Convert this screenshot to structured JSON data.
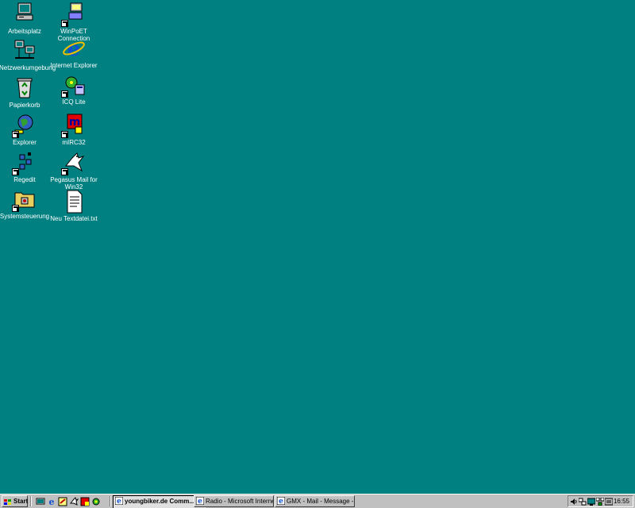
{
  "desktop": {
    "background": "#008080",
    "icons": [
      {
        "label": "Arbeitsplatz",
        "icon": "my-computer-icon"
      },
      {
        "label": "WinPoET Connection",
        "icon": "winpoet-icon"
      },
      {
        "label": "Netzwerkumgebung",
        "icon": "network-neighborhood-icon"
      },
      {
        "label": "Internet Explorer",
        "icon": "internet-explorer-icon"
      },
      {
        "label": "Papierkorb",
        "icon": "recycle-bin-icon"
      },
      {
        "label": "ICQ Lite",
        "icon": "icq-icon"
      },
      {
        "label": "Explorer",
        "icon": "explorer-icon"
      },
      {
        "label": "mIRC32",
        "icon": "mirc-icon"
      },
      {
        "label": "Regedit",
        "icon": "regedit-icon"
      },
      {
        "label": "Pegasus Mail for Win32",
        "icon": "pegasus-mail-icon"
      },
      {
        "label": "Systemsteuerung",
        "icon": "control-panel-icon"
      },
      {
        "label": "Neu Textdatei.txt",
        "icon": "text-file-icon"
      }
    ]
  },
  "taskbar": {
    "start_label": "Start",
    "tasks": [
      {
        "label": "youngbiker.de Comm...",
        "active": true
      },
      {
        "label": "Radio - Microsoft Internet ...",
        "active": false
      },
      {
        "label": "GMX - Mail - Message - M...",
        "active": false
      }
    ],
    "clock": "16:55"
  }
}
